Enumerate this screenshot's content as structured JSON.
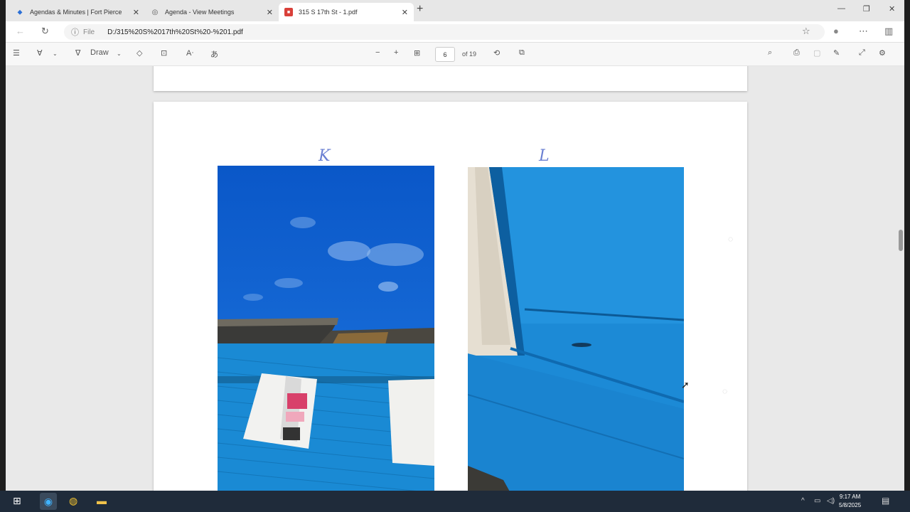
{
  "tabs": [
    {
      "label": "Agendas & Minutes | Fort Pierce",
      "icon": "city-favicon-icon",
      "active": false
    },
    {
      "label": "Agenda - View Meetings",
      "icon": "globe-icon",
      "active": false
    },
    {
      "label": "315 S 17th St - 1.pdf",
      "icon": "pdf-icon",
      "active": true
    }
  ],
  "address": {
    "scheme_label": "File",
    "url": "D:/315%20S%2017th%20St%20-%201.pdf"
  },
  "pdf_toolbar": {
    "draw_label": "Draw",
    "page_number": "6",
    "page_of": "of 19"
  },
  "page": {
    "photo_labels": [
      "K",
      "L"
    ]
  },
  "taskbar": {
    "time": "9:17 AM",
    "date": "5/8/2025"
  }
}
